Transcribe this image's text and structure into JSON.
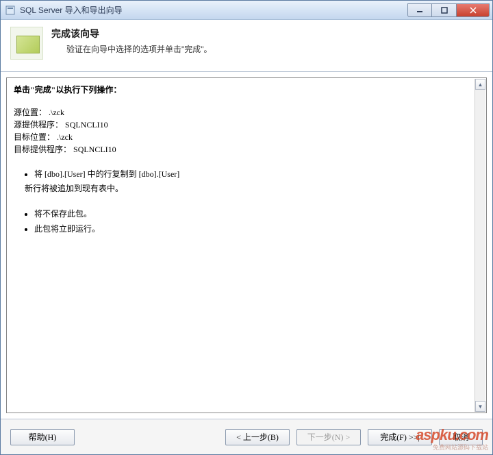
{
  "window": {
    "title": "SQL Server 导入和导出向导"
  },
  "header": {
    "title": "完成该向导",
    "subtitle": "验证在向导中选择的选项并单击\"完成\"。"
  },
  "content": {
    "section_title": "单击\"完成\"以执行下列操作：",
    "source_location_label": "源位置：",
    "source_location_value": ".\\zck",
    "source_provider_label": "源提供程序：",
    "source_provider_value": "SQLNCLI10",
    "target_location_label": "目标位置：",
    "target_location_value": ".\\zck",
    "target_provider_label": "目标提供程序：",
    "target_provider_value": "SQLNCLI10",
    "bullets_group1": [
      "将 [dbo].[User] 中的行复制到 [dbo].[User]",
      "新行将被追加到现有表中。"
    ],
    "bullets_group2": [
      "将不保存此包。",
      "此包将立即运行。"
    ]
  },
  "footer": {
    "help": "帮助(H)",
    "back": "< 上一步(B)",
    "next": "下一步(N) >",
    "finish": "完成(F) >>|",
    "cancel": "取消"
  },
  "watermark": {
    "main": "aspku.com",
    "sub": "免费网站源码下载站"
  }
}
